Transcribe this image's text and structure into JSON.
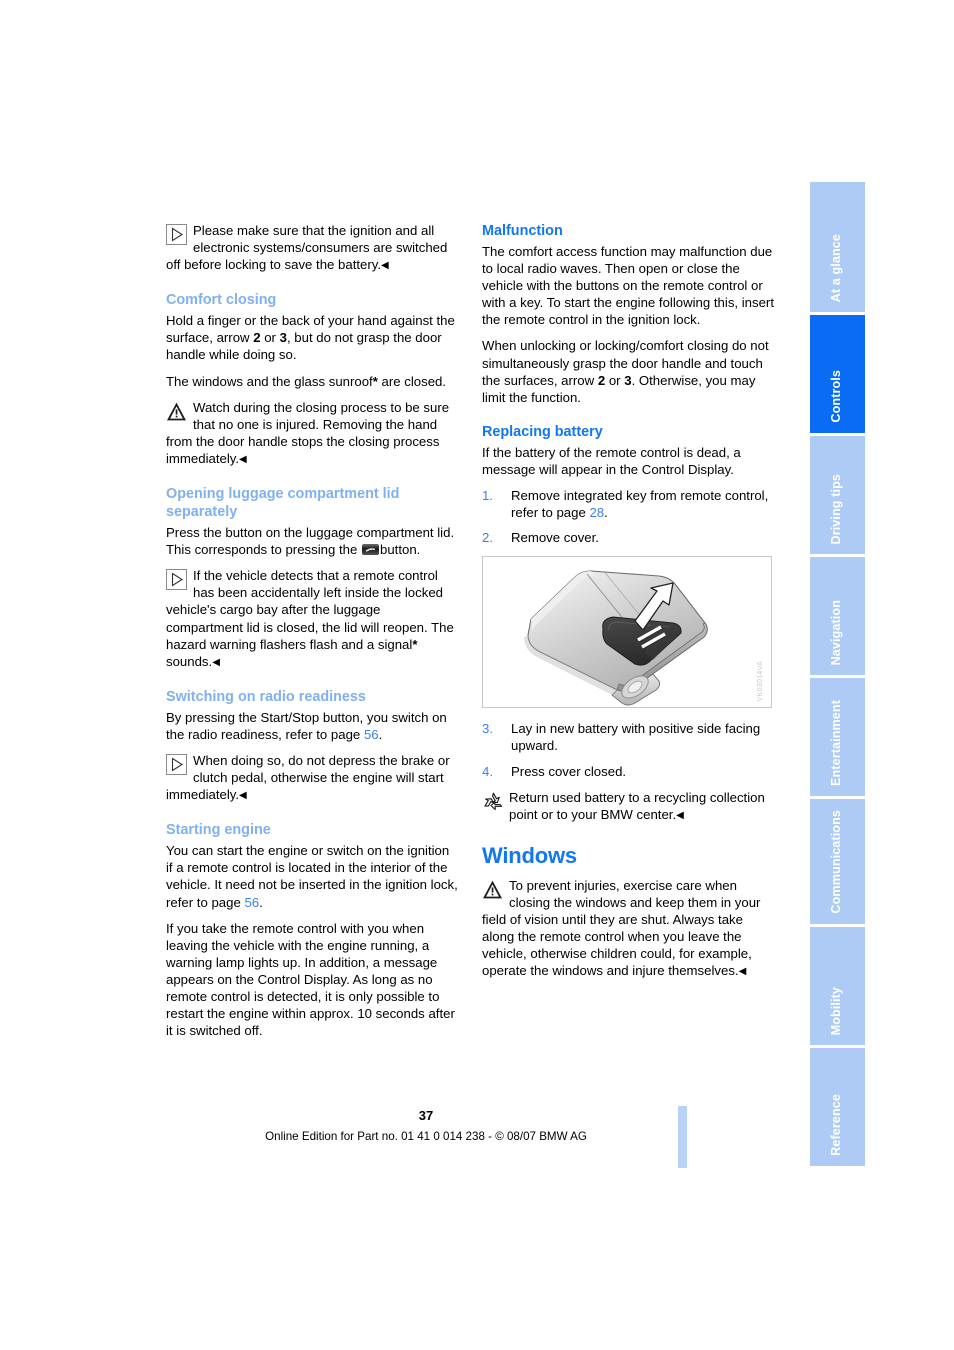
{
  "page": {
    "number": "37",
    "footer_line": "Online Edition for Part no. 01 41 0 014 238 - © 08/07 BMW AG"
  },
  "colors": {
    "heading_primary": "#1277f0",
    "heading_secondary": "#80b0f0",
    "page_ref": "#3a7ff0",
    "tab_inactive": "#aecbf5",
    "tab_active": "#0a6cf5",
    "footer_bar": "#b9d2f7"
  },
  "rail": {
    "tabs": [
      {
        "label": "At a glance",
        "active": false
      },
      {
        "label": "Controls",
        "active": true
      },
      {
        "label": "Driving tips",
        "active": false
      },
      {
        "label": "Navigation",
        "active": false
      },
      {
        "label": "Entertainment",
        "active": false
      },
      {
        "label": "Communications",
        "active": false
      },
      {
        "label": "Mobility",
        "active": false
      },
      {
        "label": "Reference",
        "active": false
      }
    ]
  },
  "left_column": {
    "note_ignition": {
      "icon": "note-icon",
      "text_a": "Please make sure that the ignition and all electronic systems/consumers are switched off before locking to save the battery.",
      "endmark": "◀"
    },
    "comfort_closing": {
      "heading": "Comfort closing",
      "para1_a": "Hold a finger or the back of your hand against the surface, arrow ",
      "para1_b": "2",
      "para1_c": " or ",
      "para1_d": "3",
      "para1_e": ", but do not grasp the door handle while doing so.",
      "para2_a": "The windows and the glass sunroof",
      "para2_star": "*",
      "para2_b": " are closed.",
      "warning": {
        "icon": "warning-triangle-icon",
        "text": "Watch during the closing process to be sure that no one is injured. Removing the hand from the door handle stops the closing process immediately.",
        "endmark": "◀"
      }
    },
    "luggage_lid": {
      "heading": "Opening luggage compartment lid separately",
      "para1_a": "Press the button on the luggage compartment lid. This corresponds to pressing the ",
      "para1_glyph": "trunk-button-icon",
      "para1_b": "button.",
      "note": {
        "icon": "note-icon",
        "text_a": "If the vehicle detects that a remote control has been accidentally left inside the locked vehicle's cargo bay after the luggage compartment lid is closed, the lid will reopen. The hazard warning flashers flash and a signal",
        "star": "*",
        "text_b": " sounds.",
        "endmark": "◀"
      }
    },
    "radio_readiness": {
      "heading": "Switching on radio readiness",
      "para1_a": "By pressing the Start/Stop button, you switch on the radio readiness, refer to page ",
      "para1_ref": "56",
      "para1_b": ".",
      "note": {
        "icon": "note-icon",
        "text": "When doing so, do not depress the brake or clutch pedal, otherwise the engine will start immediately.",
        "endmark": "◀"
      }
    },
    "starting_engine": {
      "heading": "Starting engine",
      "para1_a": "You can start the engine or switch on the ignition if a remote control is located in the interior of the vehicle. It need not be inserted in the ignition lock, refer to page ",
      "para1_ref": "56",
      "para1_b": ".",
      "para2": "If you take the remote control with you when leaving the vehicle with the engine running, a warning lamp lights up. In addition, a message appears on the Control Display. As long as no remote control is detected, it is only possible to restart the engine within approx. 10 seconds after it is switched off."
    }
  },
  "right_column": {
    "malfunction": {
      "heading": "Malfunction",
      "para1": "The comfort access function may malfunction due to local radio waves. Then open or close the vehicle with the buttons on the remote control or with a key. To start the engine following this, insert the remote control in the ignition lock.",
      "para2_a": "When unlocking or locking/comfort closing do not simultaneously grasp the door handle and touch the surfaces, arrow ",
      "para2_b": "2",
      "para2_c": " or ",
      "para2_d": "3",
      "para2_e": ". Otherwise, you may limit the function."
    },
    "replacing_battery": {
      "heading": "Replacing battery",
      "intro": "If the battery of the remote control is dead, a message will appear in the Control Display.",
      "steps_before": [
        {
          "num": "1.",
          "text_a": "Remove integrated key from remote control, refer to page ",
          "ref": "28",
          "text_b": "."
        },
        {
          "num": "2.",
          "text_a": "Remove cover.",
          "ref": "",
          "text_b": ""
        }
      ],
      "figure": {
        "name": "remote-control-battery-cover-illustration",
        "code": "VK03014VA"
      },
      "steps_after": [
        {
          "num": "3.",
          "text_a": "Lay in new battery with positive side facing upward.",
          "ref": "",
          "text_b": ""
        },
        {
          "num": "4.",
          "text_a": "Press cover closed.",
          "ref": "",
          "text_b": ""
        }
      ],
      "recycling_note": {
        "icon": "recycling-icon",
        "text": "Return used battery to a recycling collection point or to your BMW center.",
        "endmark": "◀"
      }
    },
    "windows": {
      "heading": "Windows",
      "warning": {
        "icon": "warning-triangle-icon",
        "text": "To prevent injuries, exercise care when closing the windows and keep them in your field of vision until they are shut. Always take along the remote control when you leave the vehicle, otherwise children could, for example, operate the windows and injure themselves.",
        "endmark": "◀"
      }
    }
  }
}
